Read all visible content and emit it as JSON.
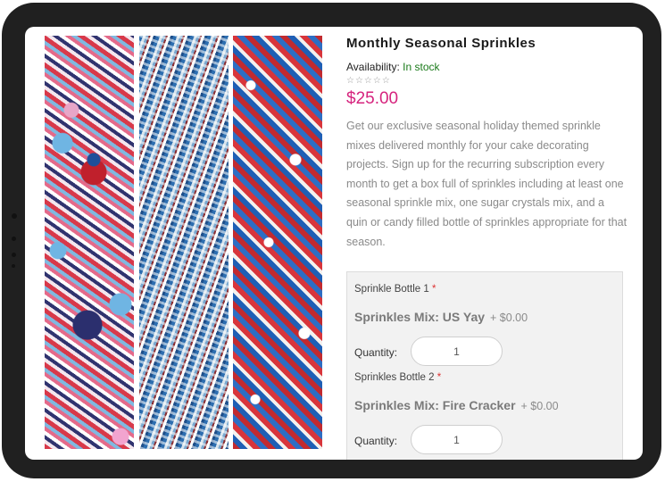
{
  "product": {
    "title": "Monthly Seasonal Sprinkles",
    "availability_label": "Availability:",
    "availability_value": "In stock",
    "rating_stars": "☆☆☆☆☆",
    "price": "$25.00",
    "description": "Get our exclusive seasonal holiday themed sprinkle mixes delivered monthly for your cake decorating projects. Sign up for the recurring subscription every month to get a box full of sprinkles including at least one seasonal sprinkle mix, one sugar crystals mix, and a quin or candy filled bottle of sprinkles appropriate for that season."
  },
  "options": [
    {
      "label": "Sprinkle Bottle 1",
      "required_mark": "*",
      "value": "Sprinkles Mix: US Yay",
      "add_price": "+ $0.00",
      "quantity_label": "Quantity:",
      "quantity": "1"
    },
    {
      "label": "Sprinkles Bottle 2",
      "required_mark": "*",
      "value": "Sprinkles Mix: Fire Cracker",
      "add_price": "+ $0.00",
      "quantity_label": "Quantity:",
      "quantity": "1"
    }
  ],
  "colors": {
    "price": "#d6247e",
    "in_stock": "#1a7a1a",
    "tablet_frame": "#202020"
  }
}
